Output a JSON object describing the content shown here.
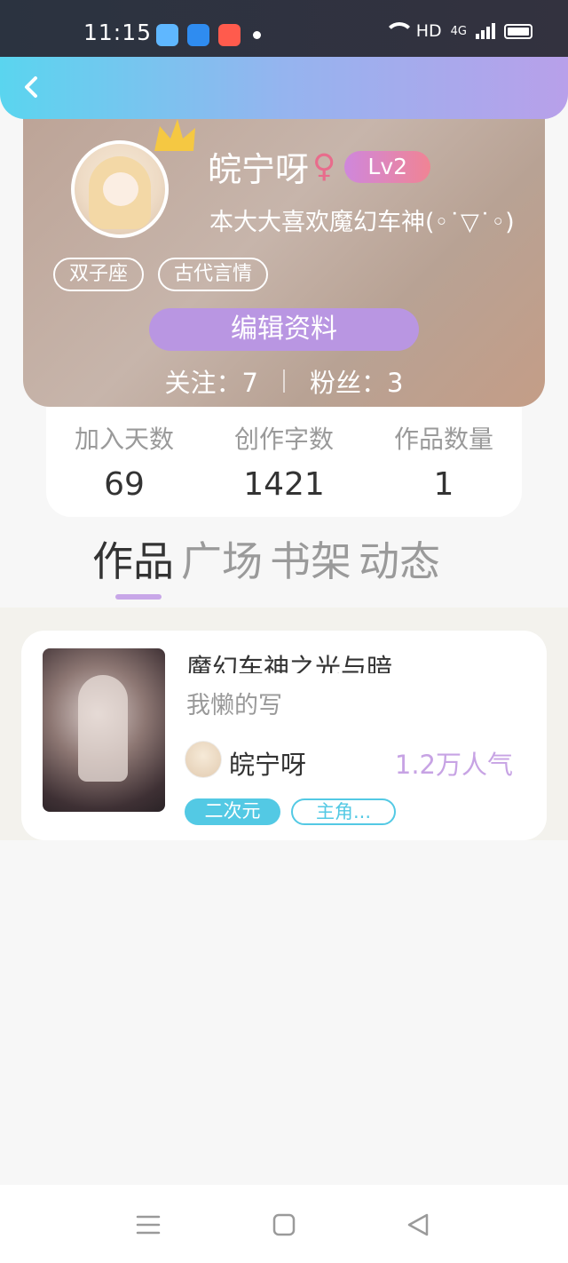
{
  "status_bar": {
    "time": "11:15",
    "network": "HD",
    "signal": "4G",
    "icons": [
      "app-icon-1",
      "app-icon-2",
      "app-icon-3",
      "wifi-icon",
      "signal-icon",
      "battery-icon"
    ]
  },
  "header": {
    "back_icon": "chevron-left-icon"
  },
  "profile": {
    "username": "皖宁呀",
    "gender_symbol": "♀",
    "level": "Lv2",
    "signature": "本大大喜欢魔幻车神(◦˙▽˙◦)",
    "tags": [
      "双子座",
      "古代言情"
    ],
    "edit_label": "编辑资料",
    "following_label": "关注：7",
    "followers_label": "粉丝：3"
  },
  "stats": [
    {
      "label": "加入天数",
      "value": "69"
    },
    {
      "label": "创作字数",
      "value": "1421"
    },
    {
      "label": "作品数量",
      "value": "1"
    }
  ],
  "tabs": [
    "作品",
    "广场",
    "书架",
    "动态"
  ],
  "active_tab": "作品",
  "work": {
    "title": "魔幻车神之光与暗",
    "description": "我懒的写",
    "author": "皖宁呀",
    "popularity": "1.2万人气",
    "tags": [
      "二次元",
      "主角..."
    ]
  },
  "colors": {
    "accent_purple": "#b996e2",
    "accent_cyan": "#53c9e4",
    "popularity": "#c7a3e4"
  },
  "nav": [
    "menu-icon",
    "home-icon",
    "back-icon"
  ]
}
